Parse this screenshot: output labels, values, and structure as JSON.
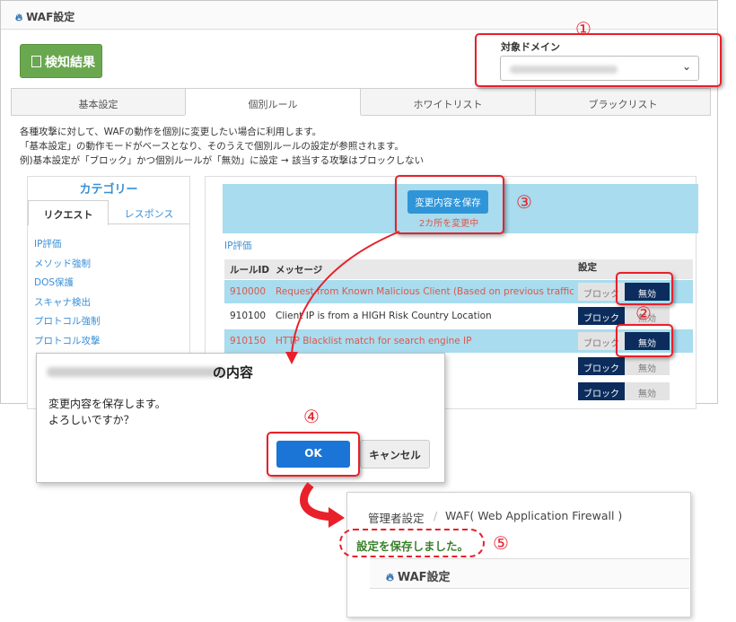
{
  "main": {
    "title": "WAF設定",
    "detect_button": "検知結果",
    "domain_label": "対象ドメイン",
    "tabs": [
      "基本設定",
      "個別ルール",
      "ホワイトリスト",
      "ブラックリスト"
    ],
    "description": [
      "各種攻撃に対して、WAFの動作を個別に変更したい場合に利用します。",
      "「基本設定」の動作モードがベースとなり、そのうえで個別ルールの設定が参照されます。",
      "例)基本設定が「ブロック」かつ個別ルールが「無効」に設定 → 該当する攻撃はブロックしない"
    ],
    "category": {
      "title": "カテゴリー",
      "tab_request": "リクエスト",
      "tab_response": "レスポンス",
      "items": [
        "IP評価",
        "メソッド強制",
        "DOS保護",
        "スキャナ検出",
        "プロトコル強制",
        "プロトコル攻撃"
      ]
    },
    "save_button": "変更内容を保存",
    "changed_count": "2カ所を変更中",
    "section_heading": "IP評価",
    "table": {
      "headers": [
        "ルールID",
        "メッセージ",
        "設定"
      ],
      "rows": [
        {
          "id": "910000",
          "message": "Request from Known Malicious Client (Based on previous traffic violatio...",
          "block": "ブロック",
          "disable": "無効"
        },
        {
          "id": "910100",
          "message": "Client IP is from a HIGH Risk Country Location",
          "block": "ブロック",
          "disable": "無効"
        },
        {
          "id": "910150",
          "message": "HTTP Blacklist match for search engine IP",
          "block": "ブロック",
          "disable": "無効"
        },
        {
          "block": "ブロック",
          "disable": "無効"
        },
        {
          "block": "ブロック",
          "disable": "無効"
        }
      ]
    }
  },
  "dialog": {
    "title_suffix": "の内容",
    "message_line1": "変更内容を保存します。",
    "message_line2": "よろしいですか？",
    "ok": "OK",
    "cancel": "キャンセル"
  },
  "result": {
    "breadcrumb_1": "管理者設定",
    "breadcrumb_sep": "/",
    "breadcrumb_2": "WAF( Web Application Firewall )",
    "saved_message": "設定を保存しました。",
    "waf_title": "WAF設定"
  },
  "annotations": [
    "①",
    "②",
    "③",
    "④",
    "⑤"
  ],
  "colors": {
    "annotation_red": "#e8202a",
    "primary_blue": "#2f95d8",
    "toggle_on_navy": "#0b2c5c",
    "highlight_row": "#a8dcee",
    "success_green": "#3a7f2a",
    "detect_green": "#6aa84f"
  }
}
